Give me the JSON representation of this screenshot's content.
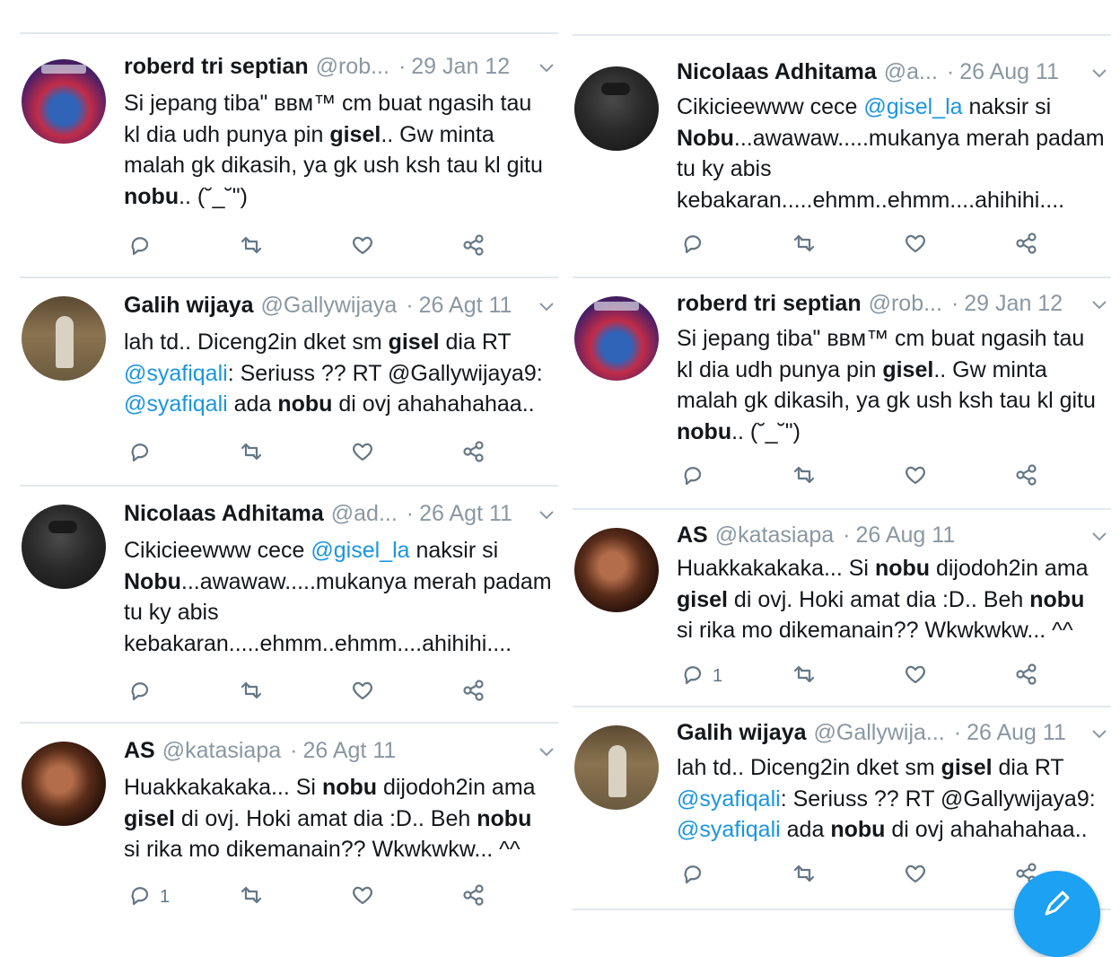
{
  "left_column": {
    "tweets": [
      {
        "name": "roberd tri septian",
        "handle": "@rob...",
        "dot": "·",
        "date": "29 Jan 12",
        "body": [
          {
            "t": "text",
            "v": "Si jepang tiba\" ʙʙᴍ™ cm buat ngasih tau kl dia udh punya pin "
          },
          {
            "t": "bold",
            "v": "gisel"
          },
          {
            "t": "text",
            "v": ".. Gw minta malah gk dikasih, ya gk ush ksh tau kl gitu "
          },
          {
            "t": "bold",
            "v": "nobu"
          },
          {
            "t": "text",
            "v": ".. (˘_˘\")"
          }
        ],
        "reply_count": ""
      },
      {
        "name": "Galih wijaya",
        "handle": "@Gallywijaya",
        "dot": "·",
        "date": "26 Agt 11",
        "body": [
          {
            "t": "text",
            "v": "lah td.. Diceng2in dket sm "
          },
          {
            "t": "bold",
            "v": "gisel"
          },
          {
            "t": "text",
            "v": " dia RT "
          },
          {
            "t": "mention",
            "v": "@syafiqali"
          },
          {
            "t": "text",
            "v": ": Seriuss ?? RT @Gallywijaya9: "
          },
          {
            "t": "mention",
            "v": "@syafiqali"
          },
          {
            "t": "text",
            "v": " ada "
          },
          {
            "t": "bold",
            "v": "nobu"
          },
          {
            "t": "text",
            "v": " di ovj ahahahahaa.."
          }
        ],
        "reply_count": ""
      },
      {
        "name": "Nicolaas Adhitama",
        "handle": "@ad...",
        "dot": "·",
        "date": "26 Agt 11",
        "body": [
          {
            "t": "text",
            "v": "Cikicieewww cece "
          },
          {
            "t": "mention",
            "v": "@gisel_la"
          },
          {
            "t": "text",
            "v": " naksir si "
          },
          {
            "t": "bold",
            "v": "Nobu"
          },
          {
            "t": "text",
            "v": "...awawaw.....mukanya merah padam tu ky abis kebakaran.....ehmm..ehmm....ahihihi...."
          }
        ],
        "reply_count": ""
      },
      {
        "name": "AS",
        "handle": "@katasiapa",
        "dot": "·",
        "date": "26 Agt 11",
        "body": [
          {
            "t": "text",
            "v": "Huakkakakaka... Si "
          },
          {
            "t": "bold",
            "v": "nobu"
          },
          {
            "t": "text",
            "v": " dijodoh2in ama "
          },
          {
            "t": "bold",
            "v": "gisel"
          },
          {
            "t": "text",
            "v": " di ovj. Hoki amat dia :D.. Beh "
          },
          {
            "t": "bold",
            "v": "nobu"
          },
          {
            "t": "text",
            "v": " si rika mo dikemanain?? Wkwkwkw... ^^"
          }
        ],
        "reply_count": "1"
      }
    ]
  },
  "right_column": {
    "tweets": [
      {
        "name": "Nicolaas Adhitama",
        "handle": "@a...",
        "dot": "·",
        "date": "26 Aug 11",
        "body": [
          {
            "t": "text",
            "v": "Cikicieewww cece "
          },
          {
            "t": "mention",
            "v": "@gisel_la"
          },
          {
            "t": "text",
            "v": " naksir si "
          },
          {
            "t": "bold",
            "v": "Nobu"
          },
          {
            "t": "text",
            "v": "...awawaw.....mukanya merah padam tu ky abis kebakaran.....ehmm..ehmm....ahihihi...."
          }
        ],
        "reply_count": ""
      },
      {
        "name": "roberd tri septian",
        "handle": "@rob...",
        "dot": "·",
        "date": "29 Jan 12",
        "body": [
          {
            "t": "text",
            "v": "Si jepang tiba\" ʙʙᴍ™ cm buat ngasih tau kl dia udh punya pin "
          },
          {
            "t": "bold",
            "v": "gisel"
          },
          {
            "t": "text",
            "v": ".. Gw minta malah gk dikasih, ya gk ush ksh tau kl gitu "
          },
          {
            "t": "bold",
            "v": "nobu"
          },
          {
            "t": "text",
            "v": ".. (˘_˘\")"
          }
        ],
        "reply_count": ""
      },
      {
        "name": "AS",
        "handle": "@katasiapa",
        "dot": "·",
        "date": "26 Aug 11",
        "body": [
          {
            "t": "text",
            "v": "Huakkakakaka... Si "
          },
          {
            "t": "bold",
            "v": "nobu"
          },
          {
            "t": "text",
            "v": " dijodoh2in ama "
          },
          {
            "t": "bold",
            "v": "gisel"
          },
          {
            "t": "text",
            "v": " di ovj. Hoki amat dia :D.. Beh "
          },
          {
            "t": "bold",
            "v": "nobu"
          },
          {
            "t": "text",
            "v": " si rika mo dikemanain?? Wkwkwkw... ^^"
          }
        ],
        "reply_count": "1"
      },
      {
        "name": "Galih wijaya",
        "handle": "@Gallywija...",
        "dot": "·",
        "date": "26 Aug 11",
        "body": [
          {
            "t": "text",
            "v": "lah td.. Diceng2in dket sm "
          },
          {
            "t": "bold",
            "v": "gisel"
          },
          {
            "t": "text",
            "v": " dia RT "
          },
          {
            "t": "mention",
            "v": "@syafiqali"
          },
          {
            "t": "text",
            "v": ": Seriuss ?? RT @Gallywijaya9: "
          },
          {
            "t": "mention",
            "v": "@syafiqali"
          },
          {
            "t": "text",
            "v": " ada "
          },
          {
            "t": "bold",
            "v": "nobu"
          },
          {
            "t": "text",
            "v": " di ovj ahahahahaa.."
          }
        ],
        "reply_count": ""
      }
    ]
  },
  "icons": {
    "reply": "reply-icon",
    "retweet": "retweet-icon",
    "like": "like-icon",
    "share": "share-icon",
    "more": "chevron-down-icon",
    "compose": "compose-icon"
  },
  "colors": {
    "mention": "#1b95e0",
    "muted": "#8a97a3",
    "divider": "#e1e8ed",
    "fab": "#1da1f2"
  }
}
